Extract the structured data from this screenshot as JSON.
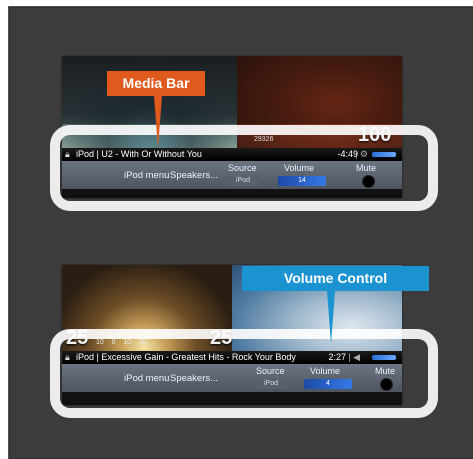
{
  "callouts": {
    "media_bar": "Media Bar",
    "volume_control": "Volume Control"
  },
  "colors": {
    "media_bar_callout": "#e15a1d",
    "volume_control_callout": "#1b93d1",
    "panel_background": "#3c3c3c"
  },
  "screens": [
    {
      "overlay_number": "100",
      "overlay_small": "29326",
      "status": {
        "source_icon": "lock-icon",
        "track": "iPod | U2 - With Or Without You",
        "time": "-4:49",
        "cfg": "|  ⚙"
      },
      "menu": {
        "ipod_menu": "iPod menu",
        "speakers": "Speakers...",
        "source_label": "Source",
        "source_value": "iPod",
        "volume_label": "Volume",
        "volume_value": "14",
        "mute_label": "Mute"
      }
    },
    {
      "overlay_left": "25",
      "overlay_right": "25",
      "overlay_scale": "10    0    10    20",
      "status": {
        "source_icon": "lock-icon",
        "track": "iPod | Excessive Gain - Greatest Hits - Rock Your Body",
        "time": "2:27",
        "cfg": "|  ◀"
      },
      "menu": {
        "ipod_menu": "iPod menu",
        "speakers": "Speakers...",
        "source_label": "Source",
        "source_value": "iPod",
        "volume_label": "Volume",
        "volume_value": "4",
        "mute_label": "Mute"
      }
    }
  ]
}
